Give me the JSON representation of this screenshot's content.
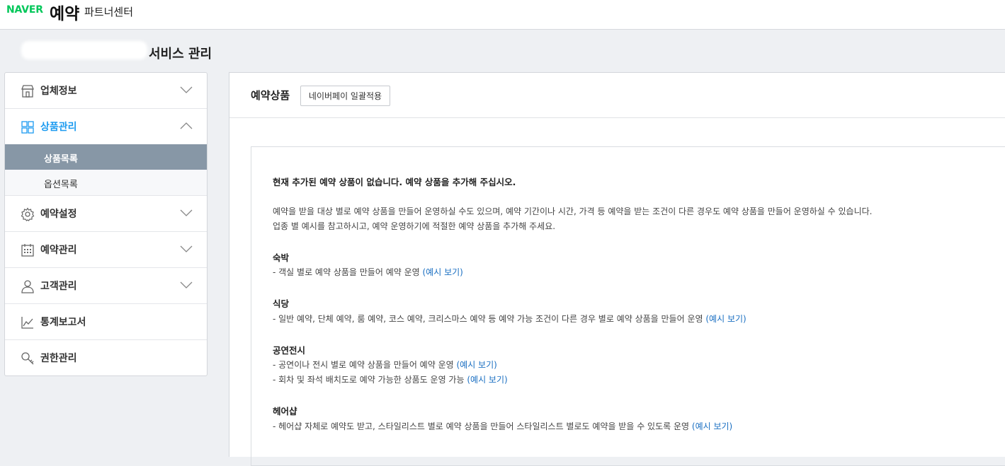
{
  "header": {
    "naver": "NAVER",
    "yeyak": "예약",
    "partner_center": "파트너센터"
  },
  "service": {
    "title": "서비스 관리"
  },
  "sidebar": {
    "items": [
      {
        "label": "업체정보",
        "icon": "store-icon"
      },
      {
        "label": "상품관리",
        "icon": "grid-icon",
        "expanded": true
      },
      {
        "label": "예약설정",
        "icon": "gear-icon"
      },
      {
        "label": "예약관리",
        "icon": "calendar-icon"
      },
      {
        "label": "고객관리",
        "icon": "person-icon"
      },
      {
        "label": "통계보고서",
        "icon": "chart-icon"
      },
      {
        "label": "권한관리",
        "icon": "key-icon"
      }
    ],
    "sub_items": [
      {
        "label": "상품목록",
        "selected": true
      },
      {
        "label": "옵션목록",
        "selected": false
      }
    ],
    "active_color": "#1d9bf0",
    "selected_bg": "#8797a6"
  },
  "main": {
    "title": "예약상품",
    "pay_button": "네이버페이 일괄적용",
    "empty_notice": "현재 추가된 예약 상품이 없습니다. 예약 상품을 추가해 주십시오.",
    "desc_line1": "예약을 받을 대상 별로 예약 상품을 만들어 운영하실 수도 있으며, 예약 기간이나 시간, 가격 등 예약을 받는 조건이 다른 경우도 예약 상품을 만들어 운영하실 수 있습니다.",
    "desc_line2": "업종 별 예시를 참고하시고, 예약 운영하기에 적절한 예약 상품을 추가해 주세요.",
    "example_link": "(예시 보기)",
    "categories": [
      {
        "title": "숙박",
        "lines": [
          "- 객실 별로 예약 상품을 만들어 예약 운영"
        ]
      },
      {
        "title": "식당",
        "lines": [
          "- 일반 예약, 단체 예약, 룸 예약, 코스 예약, 크리스마스 예약 등 예약 가능 조건이 다른 경우 별로 예약 상품을 만들어 운영"
        ]
      },
      {
        "title": "공연전시",
        "lines": [
          "- 공연이나 전시 별로 예약 상품을 만들어 예약 운영",
          "- 회차 및 좌석 배치도로 예약 가능한 상품도 운영 가능"
        ]
      },
      {
        "title": "헤어샵",
        "lines": [
          "- 헤어샵 자체로 예약도 받고, 스타일리스트 별로 예약 상품을 만들어 스타일리스트 별로도 예약을 받을 수 있도록 운영"
        ]
      }
    ],
    "link_color": "#1a6fc2"
  }
}
